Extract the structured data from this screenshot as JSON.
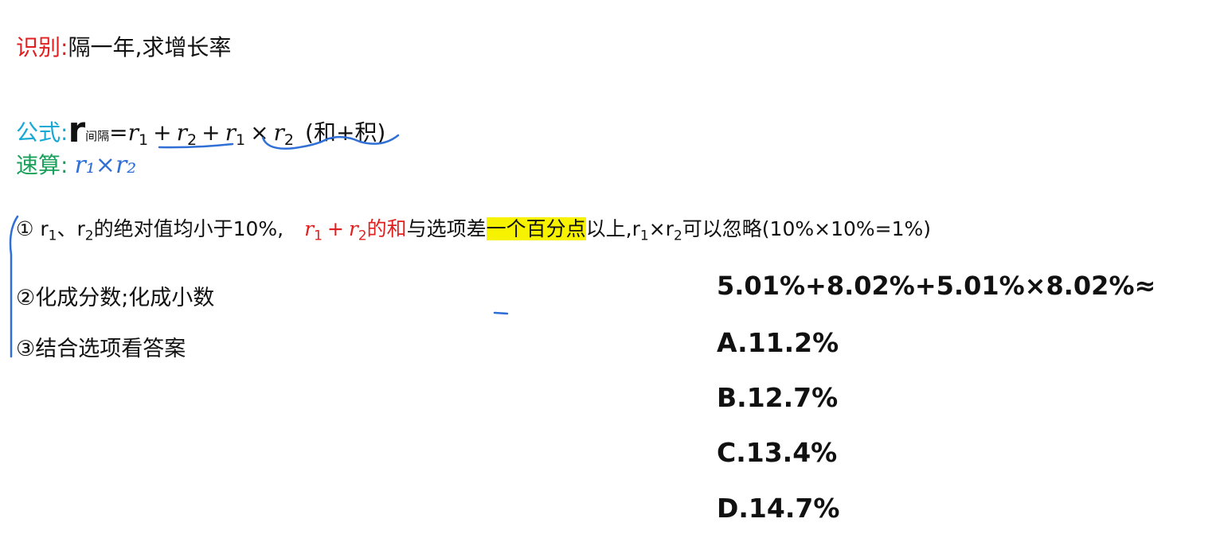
{
  "line1": {
    "label": "识别:",
    "text": "隔一年,求增长率"
  },
  "formula": {
    "label": "公式:",
    "r": "r",
    "r_sub": "间隔",
    "eq": "=",
    "r1": "r",
    "r1_sub": "1",
    "plus": "+",
    "r2": "r",
    "r2_sub": "2",
    "plus2": "+",
    "r1b": "r",
    "r1b_sub": "1",
    "times": "×",
    "r2b": "r",
    "r2b_sub": "2",
    "note": "(和+积)"
  },
  "quick": {
    "label": "速算:",
    "handwriting": "r₁×r₂"
  },
  "point1": {
    "num": "①",
    "p1": "r",
    "s1": "1",
    "p2": "、r",
    "s2": "2",
    "p3": "的绝对值均小于10%,",
    "red_r1": "r",
    "red_s1": "1",
    "red_plus": "+",
    "red_r2": "r",
    "red_s2": "2",
    "red_text": "的和",
    "p4": "与选项差",
    "highlight": "一个百分点",
    "p5": "以上,r",
    "s3": "1",
    "p6": "×r",
    "s4": "2",
    "p7": "可以忽略(10%×10%=1%)"
  },
  "point2": {
    "text": "②化成分数;化成小数"
  },
  "point3": {
    "text": "③结合选项看答案"
  },
  "question": {
    "expr": "5.01%+8.02%+5.01%×8.02%≈"
  },
  "options": [
    "A.11.2%",
    "B.12.7%",
    "C.13.4%",
    "D.14.7%"
  ],
  "colors": {
    "label_red": "#e02020",
    "label_cyan": "#17a9d6",
    "label_green": "#19a05a",
    "highlight": "#f7f200",
    "ink_blue": "#2f6fd6"
  }
}
